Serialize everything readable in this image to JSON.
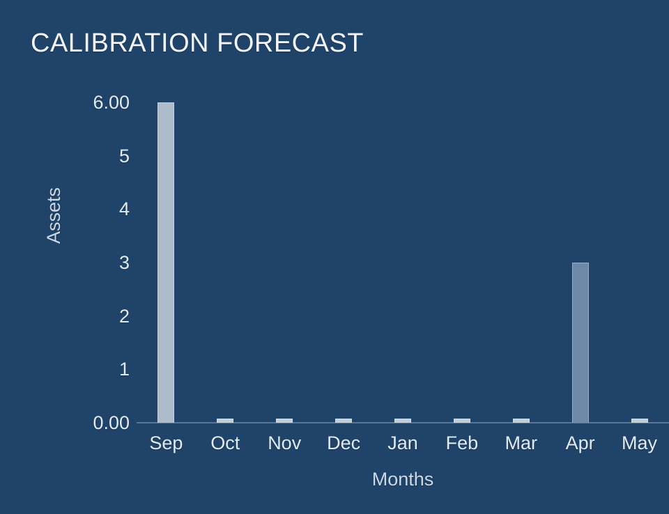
{
  "chart_data": {
    "type": "bar",
    "title": "CALIBRATION FORECAST",
    "xlabel": "Months",
    "ylabel": "Assets",
    "categories": [
      "Sep",
      "Oct",
      "Nov",
      "Dec",
      "Jan",
      "Feb",
      "Mar",
      "Apr",
      "May"
    ],
    "values": [
      6.0,
      0.08,
      0.08,
      0.08,
      0.08,
      0.08,
      0.08,
      3.0,
      0.08
    ],
    "bar_colors": [
      "#aebbca",
      "#c2ced9",
      "#c2ced9",
      "#c2ced9",
      "#c2ced9",
      "#c2ced9",
      "#c2ced9",
      "#6e8aa8",
      "#c2ced9"
    ],
    "ylim": [
      0,
      6
    ],
    "ytick_values": [
      0,
      1,
      2,
      3,
      4,
      5,
      6
    ],
    "ytick_labels": [
      "0.00",
      "1",
      "2",
      "3",
      "4",
      "5",
      "6.00"
    ],
    "grid": false,
    "legend": "none",
    "background_color": "#1f4369",
    "text_color": "#e2eaf2",
    "axis_line_color": "#55779b"
  }
}
